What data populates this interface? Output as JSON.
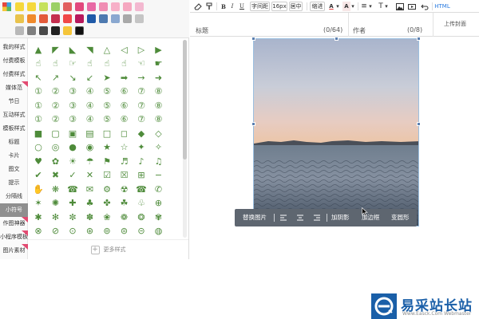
{
  "palette": {
    "rows": [
      [
        "#f5d83c",
        "#f5d83c",
        "#c6e15c",
        "#9bd066",
        "#e25f5f",
        "#e2487d",
        "#e86aa5",
        "#f08db3",
        "#f7b0c8",
        "#f5a8c0",
        "#f3b8d0"
      ],
      [
        "#e9c34c",
        "#f08a2c",
        "#e35b3b",
        "#c42f4f",
        "#f04848",
        "#b8185c",
        "#1f5aa8",
        "#4e7ab0",
        "#8aa8d0",
        "#a9a9a9",
        "#c5c5c5"
      ],
      [
        "#b8b8b8",
        "#7f7f7f",
        "#4a4a4a",
        "#222222",
        "#f5c53a",
        "#101010"
      ]
    ],
    "selected": "#101010"
  },
  "nav": {
    "items": [
      {
        "label": "我的样式",
        "flag": false
      },
      {
        "label": "付费模板",
        "flag": false
      },
      {
        "label": "付费样式",
        "flag": false
      },
      {
        "label": "媒体范",
        "flag": true
      },
      {
        "label": "节日",
        "flag": false
      },
      {
        "label": "互动样式",
        "flag": false
      },
      {
        "label": "模板样式",
        "flag": false
      },
      {
        "label": "标题",
        "flag": false
      },
      {
        "label": "卡片",
        "flag": false
      },
      {
        "label": "图文",
        "flag": false
      },
      {
        "label": "提示",
        "flag": false
      },
      {
        "label": "分隔线",
        "flag": false
      },
      {
        "label": "小符号",
        "flag": false
      },
      {
        "label": "作图神器",
        "flag": true
      },
      {
        "label": "小程序模板",
        "flag": true
      },
      {
        "label": "图片素材",
        "flag": true
      }
    ],
    "active": "小符号"
  },
  "icon_rows": [
    [
      "▲",
      "◤",
      "◣",
      "◥",
      "△",
      "◁",
      "▷",
      "▶"
    ],
    [
      "☝",
      "☝",
      "☞",
      "☝",
      "☝",
      "☝",
      "☜",
      "☛"
    ],
    [
      "↖",
      "↗",
      "↘",
      "↙",
      "➤",
      "➡",
      "→",
      "➜"
    ],
    [
      "①",
      "②",
      "③",
      "④",
      "⑤",
      "⑥",
      "⑦",
      "⑧"
    ],
    [
      "①",
      "②",
      "③",
      "④",
      "⑤",
      "⑥",
      "⑦",
      "⑧"
    ],
    [
      "①",
      "②",
      "③",
      "④",
      "⑤",
      "⑥",
      "⑦",
      "⑧"
    ],
    [
      "■",
      "▢",
      "▣",
      "▤",
      "□",
      "◻",
      "◆",
      "◇"
    ],
    [
      "○",
      "◎",
      "●",
      "◉",
      "★",
      "☆",
      "✦",
      "✧"
    ],
    [
      "♥",
      "✿",
      "☀",
      "☂",
      "⚑",
      "♬",
      "♪",
      "♫"
    ],
    [
      "✔",
      "✖",
      "✓",
      "✕",
      "☑",
      "☒",
      "⊞",
      "−"
    ],
    [
      "✋",
      "❋",
      "☎",
      "✉",
      "⚙",
      "☢",
      "☎",
      "✆"
    ],
    [
      "✶",
      "✺",
      "✚",
      "♣",
      "✤",
      "☘",
      "♧",
      "⊕"
    ],
    [
      "✱",
      "✻",
      "✼",
      "✽",
      "❀",
      "❁",
      "❂",
      "✾"
    ],
    [
      "⊗",
      "⊘",
      "⊙",
      "⊛",
      "⊚",
      "⊜",
      "⊝",
      "◍"
    ]
  ],
  "more_label": "更多样式",
  "toolbar": {
    "bold": "B",
    "italic": "I",
    "underline": "U",
    "letter_spacing": "字间距",
    "font_size": "16px",
    "align_center": "居中",
    "indent": "缩进",
    "text_color": "A",
    "bg_color": "A",
    "list": "≡",
    "heading": "T",
    "html": "HTML"
  },
  "fields": {
    "title_label": "标题",
    "title_count": "(0/64)",
    "author_label": "作者",
    "author_count": "(0/8)",
    "upload_cover": "上传封面"
  },
  "image_toolbar": {
    "replace": "替换图片",
    "add_shadow": "加阴影",
    "add_border": "加边框",
    "transform": "变圆形"
  },
  "watermark": {
    "logo_letter": "e",
    "text": "易采站长站",
    "sub": "Www.Easck.Com  Webmaster"
  }
}
